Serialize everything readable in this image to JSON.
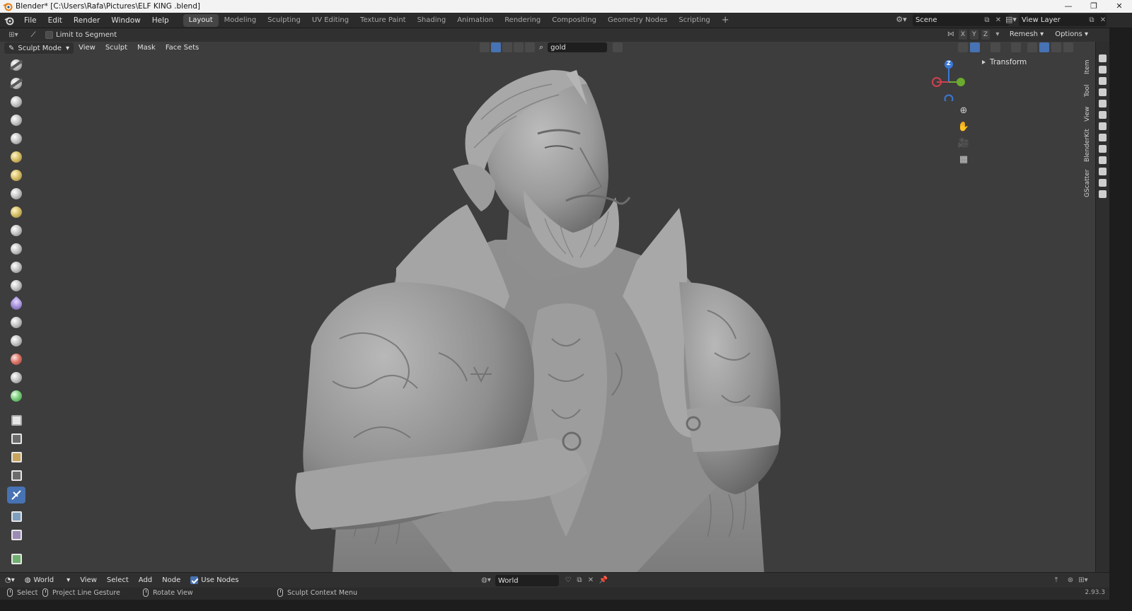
{
  "window": {
    "title": "Blender* [C:\\Users\\Rafa\\Pictures\\ELF KING .blend]",
    "minimize": "—",
    "maximize": "❐",
    "close": "✕"
  },
  "menu": [
    "File",
    "Edit",
    "Render",
    "Window",
    "Help"
  ],
  "workspaces": [
    "Layout",
    "Modeling",
    "Sculpting",
    "UV Editing",
    "Texture Paint",
    "Shading",
    "Animation",
    "Rendering",
    "Compositing",
    "Geometry Nodes",
    "Scripting"
  ],
  "active_workspace": "Layout",
  "scene": {
    "label": "Scene"
  },
  "view_layer": {
    "label": "View Layer"
  },
  "tool_settings": {
    "limit_to_segment": "Limit to Segment",
    "limit_checked": false,
    "axes": [
      "X",
      "Y",
      "Z"
    ],
    "remesh": "Remesh",
    "options": "Options"
  },
  "viewport_header": {
    "mode": "Sculpt Mode",
    "menus": [
      "View",
      "Sculpt",
      "Mask",
      "Face Sets"
    ],
    "search_value": "gold"
  },
  "gizmo": {
    "z": "Z"
  },
  "npanel": {
    "section": "Transform",
    "tabs": [
      "Item",
      "Tool",
      "View",
      "BlenderKit",
      "GScatter"
    ]
  },
  "bottom_header": {
    "world_type": "World",
    "menus": [
      "View",
      "Select",
      "Add",
      "Node"
    ],
    "use_nodes": "Use Nodes",
    "use_nodes_checked": true,
    "world_value": "World"
  },
  "status": {
    "select": "Select",
    "gesture": "Project Line Gesture",
    "rotate": "Rotate View",
    "context": "Sculpt Context Menu",
    "version": "2.93.3"
  },
  "colors": {
    "accent": "#4772b3",
    "axis_x": "#d04050",
    "axis_y": "#6bab2f",
    "axis_z": "#3a78d8"
  }
}
